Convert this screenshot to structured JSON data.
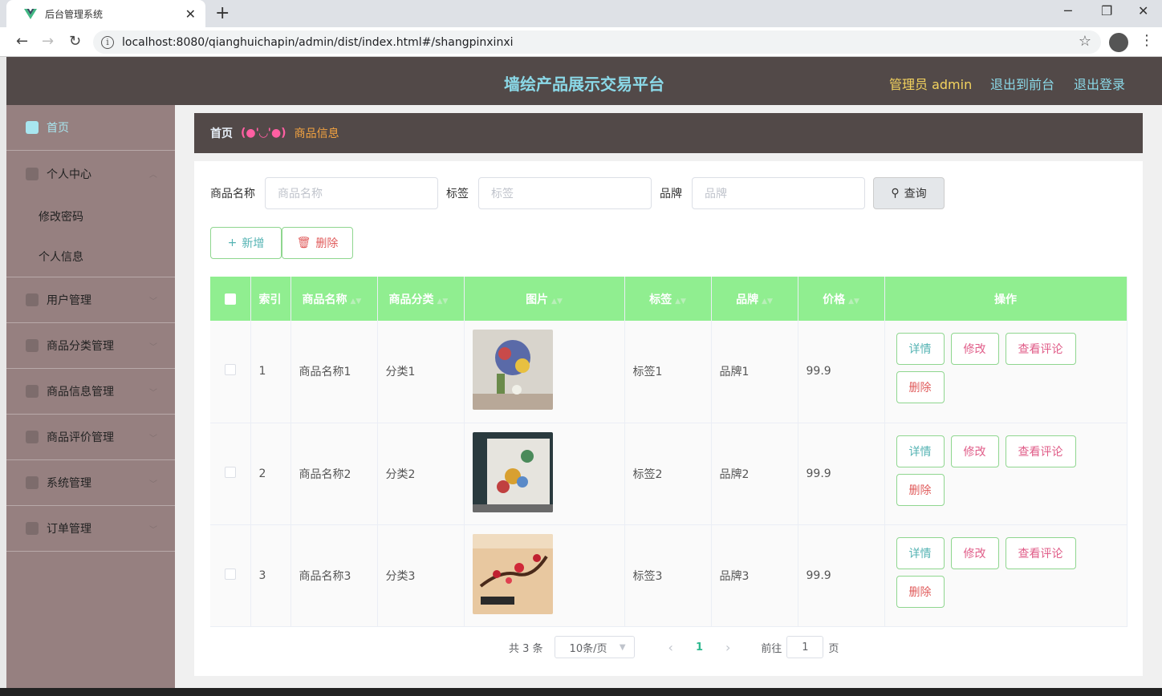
{
  "browser": {
    "tab_title": "后台管理系统",
    "url": "localhost:8080/qianghuichapin/admin/dist/index.html#/shangpinxinxi"
  },
  "header": {
    "title": "墙绘产品展示交易平台",
    "admin_label": "管理员 admin",
    "to_front": "退出到前台",
    "logout": "退出登录"
  },
  "sidebar": {
    "items": [
      {
        "label": "首页"
      },
      {
        "label": "个人中心",
        "sub": [
          "修改密码",
          "个人信息"
        ]
      },
      {
        "label": "用户管理"
      },
      {
        "label": "商品分类管理"
      },
      {
        "label": "商品信息管理"
      },
      {
        "label": "商品评价管理"
      },
      {
        "label": "系统管理"
      },
      {
        "label": "订单管理"
      }
    ]
  },
  "breadcrumb": {
    "home": "首页",
    "sep": "(●'◡'●)",
    "current": "商品信息"
  },
  "search": {
    "name_label": "商品名称",
    "name_placeholder": "商品名称",
    "tag_label": "标签",
    "tag_placeholder": "标签",
    "brand_label": "品牌",
    "brand_placeholder": "品牌",
    "query": "查询"
  },
  "actions": {
    "add": "新增",
    "delete": "删除"
  },
  "table": {
    "headers": [
      "索引",
      "商品名称",
      "商品分类",
      "图片",
      "标签",
      "品牌",
      "价格",
      "操作"
    ],
    "rows": [
      {
        "index": "1",
        "name": "商品名称1",
        "category": "分类1",
        "tag": "标签1",
        "brand": "品牌1",
        "price": "99.9"
      },
      {
        "index": "2",
        "name": "商品名称2",
        "category": "分类2",
        "tag": "标签2",
        "brand": "品牌2",
        "price": "99.9"
      },
      {
        "index": "3",
        "name": "商品名称3",
        "category": "分类3",
        "tag": "标签3",
        "brand": "品牌3",
        "price": "99.9"
      }
    ],
    "ops": {
      "detail": "详情",
      "edit": "修改",
      "review": "查看评论",
      "delete": "删除"
    }
  },
  "pagination": {
    "total": "共 3 条",
    "page_size": "10条/页",
    "current": "1",
    "goto": "前往",
    "goto_value": "1",
    "page_unit": "页"
  },
  "colors": {
    "header_bg": "#524948",
    "sidebar_bg": "#968080",
    "table_header": "#90ee90",
    "title": "#8bd9e8"
  }
}
